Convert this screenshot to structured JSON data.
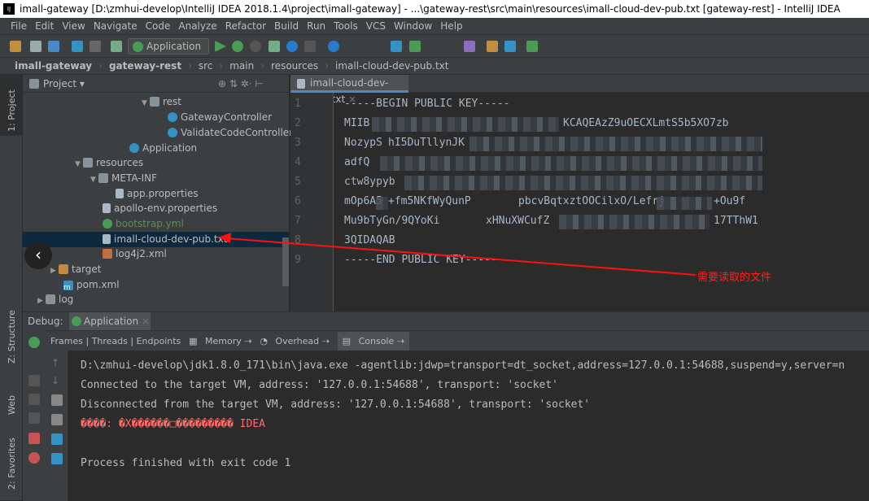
{
  "window": {
    "title": "imall-gateway [D:\\zmhui-develop\\IntelliJ IDEA 2018.1.4\\project\\imall-gateway] - ...\\gateway-rest\\src\\main\\resources\\imall-cloud-dev-pub.txt [gateway-rest] - IntelliJ IDEA",
    "logo": "IJ"
  },
  "menu": [
    "File",
    "Edit",
    "View",
    "Navigate",
    "Code",
    "Analyze",
    "Refactor",
    "Build",
    "Run",
    "Tools",
    "VCS",
    "Window",
    "Help"
  ],
  "toolbar": {
    "run_config": "Application"
  },
  "breadcrumb": [
    "imall-gateway",
    "gateway-rest",
    "src",
    "main",
    "resources",
    "imall-cloud-dev-pub.txt"
  ],
  "left_strip": {
    "project": "1: Project",
    "structure": "Z: Structure",
    "web": "Web",
    "favorites": "2: Favorites"
  },
  "project_panel": {
    "title": "Project",
    "items": [
      {
        "label": "rest",
        "type": "folder"
      },
      {
        "label": "GatewayController",
        "type": "class"
      },
      {
        "label": "ValidateCodeController",
        "type": "class"
      },
      {
        "label": "Application",
        "type": "class"
      },
      {
        "label": "resources",
        "type": "folder"
      },
      {
        "label": "META-INF",
        "type": "folder"
      },
      {
        "label": "app.properties",
        "type": "file"
      },
      {
        "label": "apollo-env.properties",
        "type": "file"
      },
      {
        "label": "bootstrap.yml",
        "type": "file"
      },
      {
        "label": "imall-cloud-dev-pub.txt",
        "type": "file",
        "selected": true
      },
      {
        "label": "log4j2.xml",
        "type": "file"
      },
      {
        "label": "target",
        "type": "folder"
      },
      {
        "label": "pom.xml",
        "type": "file"
      },
      {
        "label": "log",
        "type": "folder"
      }
    ]
  },
  "editor": {
    "tab": "imall-cloud-dev-pub.txt",
    "lines": [
      "-----BEGIN PUBLIC KEY-----",
      "MIIB",
      "KCAQEAzZ9uOECXLmtS5b5XO7zb",
      "NozypS",
      "hI5DuTllynJK",
      "adfQ",
      "ctw8ypyb",
      "mOp6A5",
      "+fm5NKfWyQunP",
      "pbcvBqtxztOOCilxO/Lefrj",
      "+Ou9f",
      "Mu9bTyGn/9QYoKi",
      "xHNuXWCufZ",
      "17TThW1",
      "3QIDAQAB",
      "-----END PUBLIC KEY-----"
    ],
    "line_numbers": [
      "1",
      "2",
      "3",
      "4",
      "5",
      "6",
      "7",
      "8",
      "9"
    ]
  },
  "annotation": "需要读取的文件",
  "debug": {
    "label": "Debug:",
    "tab": "Application",
    "tabs": [
      "Frames | Threads | Endpoints",
      "Memory",
      "Overhead",
      "Console"
    ],
    "console": [
      "D:\\zmhui-develop\\jdk1.8.0_171\\bin\\java.exe -agentlib:jdwp=transport=dt_socket,address=127.0.0.1:54688,suspend=y,server=n",
      "Connected to the target VM, address: '127.0.0.1:54688', transport: 'socket'",
      "Disconnected from the target VM, address: '127.0.0.1:54688', transport: 'socket'",
      "����: �X������□��������� IDEA",
      "Process finished with exit code 1"
    ]
  },
  "colors": {
    "accent": "#4a88c7",
    "error": "#ff6b68",
    "annotation": "#ff2020",
    "selection": "#0d293e"
  }
}
